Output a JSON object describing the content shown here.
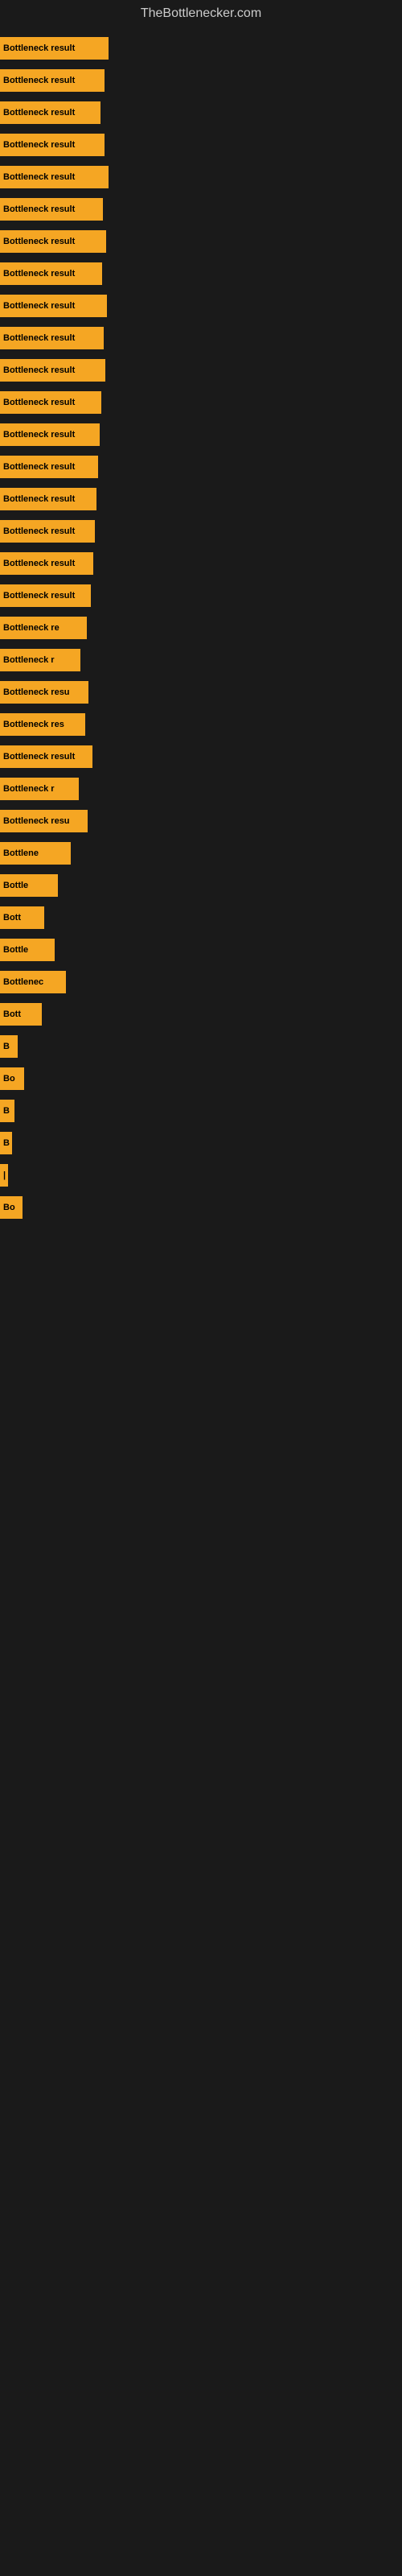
{
  "site": {
    "title": "TheBottlenecker.com"
  },
  "bars": [
    {
      "label": "Bottleneck result",
      "width": 135
    },
    {
      "label": "Bottleneck result",
      "width": 130
    },
    {
      "label": "Bottleneck result",
      "width": 125
    },
    {
      "label": "Bottleneck result",
      "width": 130
    },
    {
      "label": "Bottleneck result",
      "width": 135
    },
    {
      "label": "Bottleneck result",
      "width": 128
    },
    {
      "label": "Bottleneck result",
      "width": 132
    },
    {
      "label": "Bottleneck result",
      "width": 127
    },
    {
      "label": "Bottleneck result",
      "width": 133
    },
    {
      "label": "Bottleneck result",
      "width": 129
    },
    {
      "label": "Bottleneck result",
      "width": 131
    },
    {
      "label": "Bottleneck result",
      "width": 126
    },
    {
      "label": "Bottleneck result",
      "width": 124
    },
    {
      "label": "Bottleneck result",
      "width": 122
    },
    {
      "label": "Bottleneck result",
      "width": 120
    },
    {
      "label": "Bottleneck result",
      "width": 118
    },
    {
      "label": "Bottleneck result",
      "width": 116
    },
    {
      "label": "Bottleneck result",
      "width": 113
    },
    {
      "label": "Bottleneck re",
      "width": 108
    },
    {
      "label": "Bottleneck r",
      "width": 100
    },
    {
      "label": "Bottleneck resu",
      "width": 110
    },
    {
      "label": "Bottleneck res",
      "width": 106
    },
    {
      "label": "Bottleneck result",
      "width": 115
    },
    {
      "label": "Bottleneck r",
      "width": 98
    },
    {
      "label": "Bottleneck resu",
      "width": 109
    },
    {
      "label": "Bottlene",
      "width": 88
    },
    {
      "label": "Bottle",
      "width": 72
    },
    {
      "label": "Bott",
      "width": 55
    },
    {
      "label": "Bottle",
      "width": 68
    },
    {
      "label": "Bottlenec",
      "width": 82
    },
    {
      "label": "Bott",
      "width": 52
    },
    {
      "label": "B",
      "width": 22
    },
    {
      "label": "Bo",
      "width": 30
    },
    {
      "label": "B",
      "width": 18
    },
    {
      "label": "B",
      "width": 15
    },
    {
      "label": "|",
      "width": 10
    },
    {
      "label": "Bo",
      "width": 28
    }
  ]
}
